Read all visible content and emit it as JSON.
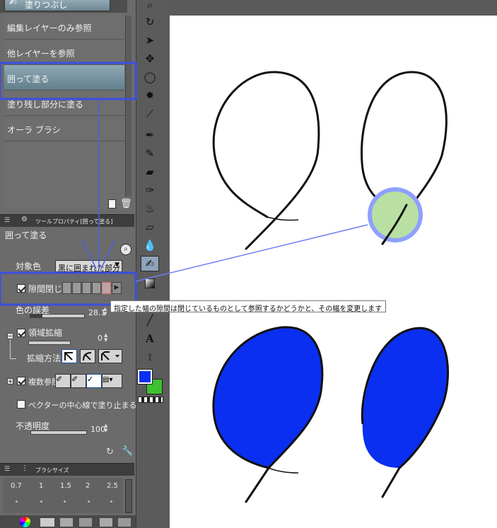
{
  "tool_panel": {
    "active_tool": "塗りつぶし",
    "sub_tools": [
      {
        "label": "編集レイヤーのみ参照",
        "selected": false
      },
      {
        "label": "他レイヤーを参照",
        "selected": false
      },
      {
        "label": "囲って塗る",
        "selected": true
      },
      {
        "label": "塗り残し部分に塗る",
        "selected": false
      },
      {
        "label": "オーラ ブラシ",
        "selected": false
      }
    ]
  },
  "tool_property": {
    "panel_title": "ツールプロパティ[囲って塗る]",
    "tool_name": "囲って塗る",
    "target_color_label": "対象色",
    "target_color_value": "黒に囲まれた部分",
    "close_gap_label": "隙間閉じ",
    "color_margin_label": "色の誤差",
    "color_margin_value": "28.1",
    "area_scaling_label": "領域拡縮",
    "area_scaling_value": "0",
    "scaling_method_label": "拡縮方法",
    "multi_ref_label": "複数参照",
    "vector_center_label": "ベクターの中心線で塗り止まる",
    "opacity_label": "不透明度",
    "opacity_value": "100"
  },
  "tooltip": "指定した幅の隙間は閉じているものとして参照するかどうかと、その幅を変更します",
  "brush_size": {
    "panel_title": "ブラシサイズ",
    "values": [
      "0.7",
      "1",
      "1.5",
      "2",
      "2.5"
    ]
  },
  "colors": {
    "main_color": "#0a2ff0",
    "sub_color": "#3fc22f",
    "highlight_blue": "#3b4fe0",
    "gap_circle_fill": "#b9e0a2",
    "gap_circle_ring": "#8ea0ff"
  }
}
